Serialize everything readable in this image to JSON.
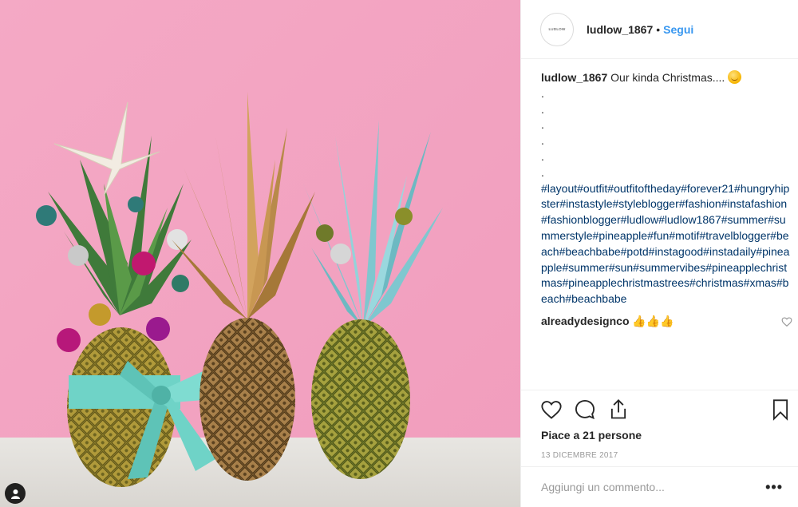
{
  "header": {
    "avatar_text": "LUDLOW",
    "username": "ludlow_1867",
    "separator": "•",
    "follow_label": "Segui"
  },
  "caption": {
    "username": "ludlow_1867",
    "text": "Our kinda Christmas....",
    "emoji": "smiling-face-icon",
    "dots": [
      ".",
      ".",
      ".",
      ".",
      ".",
      "."
    ],
    "hashtags": "#layout#outfit#outfitoftheday#forever21#hungryhipster#instastyle#styleblogger#fashion#instafashion#fashionblogger#ludlow#ludlow1867#summer#summerstyle#pineapple#fun#motif#travelblogger#beach#beachbabe#potd#instagood#instadaily#pineapple#summer#sun#summervibes#pineapplechristmas#pineapplechristmastrees#christmas#xmas#beach#beachbabe"
  },
  "comment": {
    "username": "alreadydesignco",
    "text": "👍👍👍"
  },
  "likes_text": "Piace a 21 persone",
  "date_text": "13 DICEMBRE 2017",
  "comment_placeholder": "Aggiungi un commento...",
  "more_label": "•••",
  "colors": {
    "link": "#3897f0",
    "hashtag": "#003569",
    "background_pink": "#f3a8c4"
  }
}
